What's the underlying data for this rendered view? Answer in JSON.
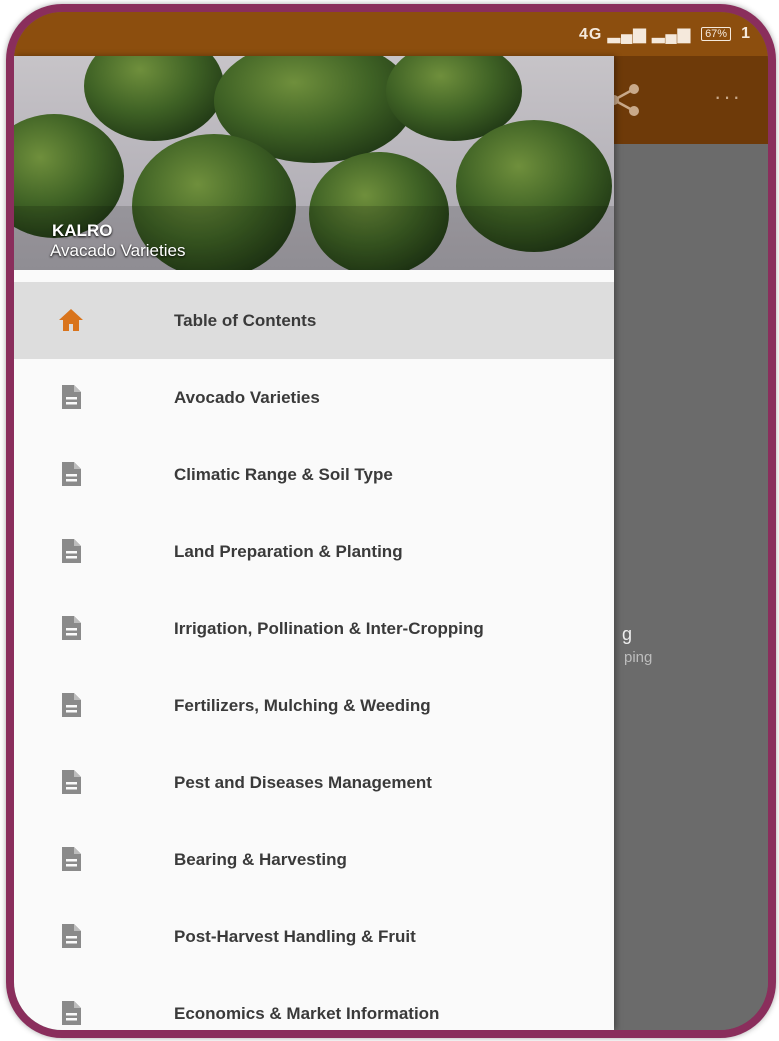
{
  "status_bar": {
    "network": "4G",
    "battery": "67%",
    "time": "1"
  },
  "toolbar": {
    "share_icon": "share-icon",
    "more_icon": "more-icon"
  },
  "background_content": {
    "title_fragment": "g",
    "subtitle_fragment": "ping"
  },
  "drawer": {
    "header": {
      "title": "KALRO",
      "subtitle": "Avacado Varieties"
    },
    "items": [
      {
        "label": "Table of Contents",
        "icon": "home-icon",
        "active": true
      },
      {
        "label": "Avocado Varieties",
        "icon": "document-icon"
      },
      {
        "label": "Climatic Range & Soil Type",
        "icon": "document-icon"
      },
      {
        "label": "Land Preparation & Planting",
        "icon": "document-icon"
      },
      {
        "label": "Irrigation, Pollination & Inter-Cropping",
        "icon": "document-icon"
      },
      {
        "label": "Fertilizers, Mulching & Weeding",
        "icon": "document-icon"
      },
      {
        "label": "Pest and Diseases Management",
        "icon": "document-icon"
      },
      {
        "label": "Bearing & Harvesting",
        "icon": "document-icon"
      },
      {
        "label": "Post-Harvest Handling & Fruit",
        "icon": "document-icon"
      },
      {
        "label": "Economics & Market Information",
        "icon": "document-icon"
      }
    ]
  },
  "colors": {
    "status_bar": "#8c4e0e",
    "toolbar": "#6e3a09",
    "home_icon": "#d9741c",
    "doc_icon": "#8a8a8a",
    "frame": "#8a2e5c"
  }
}
